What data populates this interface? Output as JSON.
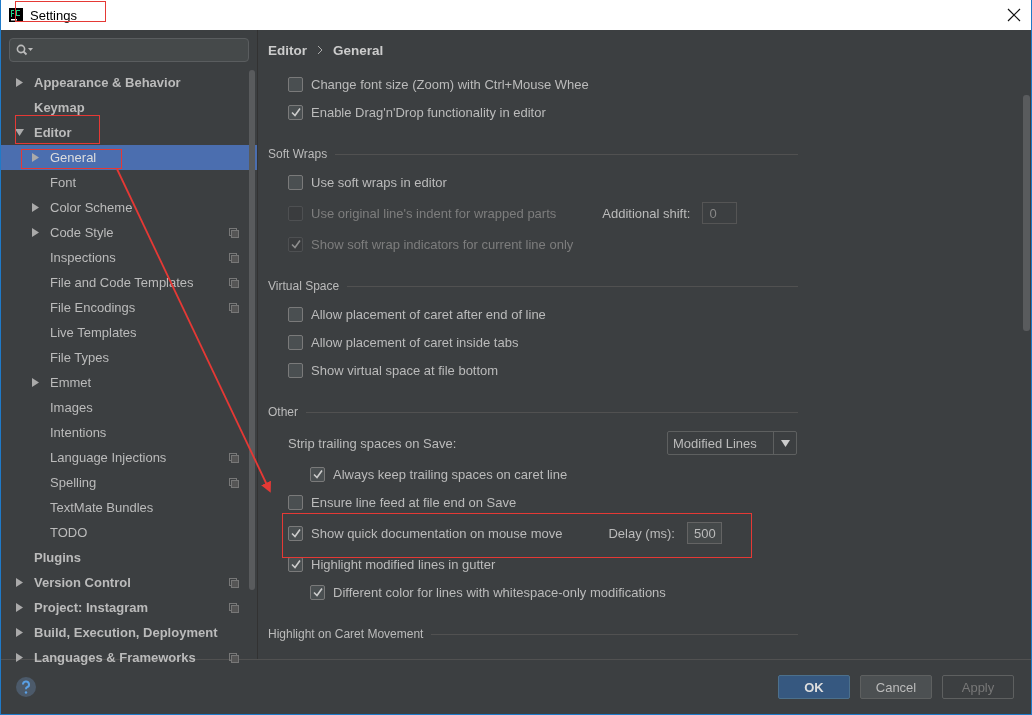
{
  "window": {
    "title": "Settings"
  },
  "sidebar": {
    "items": [
      {
        "label": "Appearance & Behavior",
        "expanded": false,
        "selected": false,
        "project_scope": false
      },
      {
        "label": "Keymap",
        "selected": false,
        "project_scope": false
      },
      {
        "label": "Editor",
        "expanded": true,
        "selected": false,
        "project_scope": false,
        "children": [
          {
            "label": "General",
            "expanded": false,
            "selected": true,
            "project_scope": false
          },
          {
            "label": "Font",
            "selected": false,
            "project_scope": false
          },
          {
            "label": "Color Scheme",
            "expanded": false,
            "selected": false,
            "project_scope": false
          },
          {
            "label": "Code Style",
            "expanded": false,
            "selected": false,
            "project_scope": true
          },
          {
            "label": "Inspections",
            "selected": false,
            "project_scope": true
          },
          {
            "label": "File and Code Templates",
            "selected": false,
            "project_scope": true
          },
          {
            "label": "File Encodings",
            "selected": false,
            "project_scope": true
          },
          {
            "label": "Live Templates",
            "selected": false,
            "project_scope": false
          },
          {
            "label": "File Types",
            "selected": false,
            "project_scope": false
          },
          {
            "label": "Emmet",
            "expanded": false,
            "selected": false,
            "project_scope": false
          },
          {
            "label": "Images",
            "selected": false,
            "project_scope": false
          },
          {
            "label": "Intentions",
            "selected": false,
            "project_scope": false
          },
          {
            "label": "Language Injections",
            "selected": false,
            "project_scope": true
          },
          {
            "label": "Spelling",
            "selected": false,
            "project_scope": true
          },
          {
            "label": "TextMate Bundles",
            "selected": false,
            "project_scope": false
          },
          {
            "label": "TODO",
            "selected": false,
            "project_scope": false
          }
        ]
      },
      {
        "label": "Plugins",
        "selected": false,
        "project_scope": false
      },
      {
        "label": "Version Control",
        "expanded": false,
        "selected": false,
        "project_scope": true
      },
      {
        "label": "Project: Instagram",
        "expanded": false,
        "selected": false,
        "project_scope": true
      },
      {
        "label": "Build, Execution, Deployment",
        "expanded": false,
        "selected": false,
        "project_scope": false
      },
      {
        "label": "Languages & Frameworks",
        "expanded": false,
        "selected": false,
        "project_scope": true
      }
    ]
  },
  "breadcrumb": [
    "Editor",
    "General"
  ],
  "sections": [
    {
      "items": [
        {
          "kind": "checkbox",
          "label": "Change font size (Zoom) with Ctrl+Mouse Whee",
          "checked": false,
          "disabled": false
        },
        {
          "kind": "checkbox",
          "label": "Enable Drag'n'Drop functionality in editor",
          "checked": true,
          "disabled": false
        }
      ]
    },
    {
      "title": "Soft Wraps",
      "items": [
        {
          "kind": "checkbox",
          "label": "Use soft wraps in editor",
          "checked": false,
          "disabled": false
        },
        {
          "kind": "checkbox",
          "label": "Use original line's indent for wrapped parts",
          "checked": false,
          "disabled": true,
          "field_label": "Additional shift:",
          "field_value": "0"
        },
        {
          "kind": "checkbox",
          "label": "Show soft wrap indicators for current line only",
          "checked": true,
          "disabled": true
        }
      ]
    },
    {
      "title": "Virtual Space",
      "items": [
        {
          "kind": "checkbox",
          "label": "Allow placement of caret after end of line",
          "checked": false,
          "disabled": false
        },
        {
          "kind": "checkbox",
          "label": "Allow placement of caret inside tabs",
          "checked": false,
          "disabled": false
        },
        {
          "kind": "checkbox",
          "label": "Show virtual space at file bottom",
          "checked": false,
          "disabled": false
        }
      ]
    },
    {
      "title": "Other",
      "items": [
        {
          "kind": "dropdown",
          "label": "Strip trailing spaces on Save:",
          "value": "Modified Lines",
          "children": [
            {
              "kind": "checkbox",
              "label": "Always keep trailing spaces on caret line",
              "checked": true,
              "disabled": false
            }
          ]
        },
        {
          "kind": "checkbox",
          "label": "Ensure line feed at file end on Save",
          "checked": false,
          "disabled": false
        },
        {
          "kind": "checkbox",
          "label": "Show quick documentation on mouse move",
          "checked": true,
          "disabled": false,
          "field_label": "Delay (ms):",
          "field_value": "500"
        },
        {
          "kind": "checkbox",
          "label": "Highlight modified lines in gutter",
          "checked": true,
          "disabled": false,
          "children": [
            {
              "kind": "checkbox",
              "label": "Different color for lines with whitespace-only modifications",
              "checked": true,
              "disabled": false
            }
          ]
        }
      ]
    },
    {
      "title": "Highlight on Caret Movement"
    }
  ],
  "buttons": [
    {
      "label": "OK",
      "kind": "primary",
      "disabled": false
    },
    {
      "label": "Cancel",
      "kind": "normal",
      "disabled": false
    },
    {
      "label": "Apply",
      "kind": "normal",
      "disabled": true
    }
  ]
}
